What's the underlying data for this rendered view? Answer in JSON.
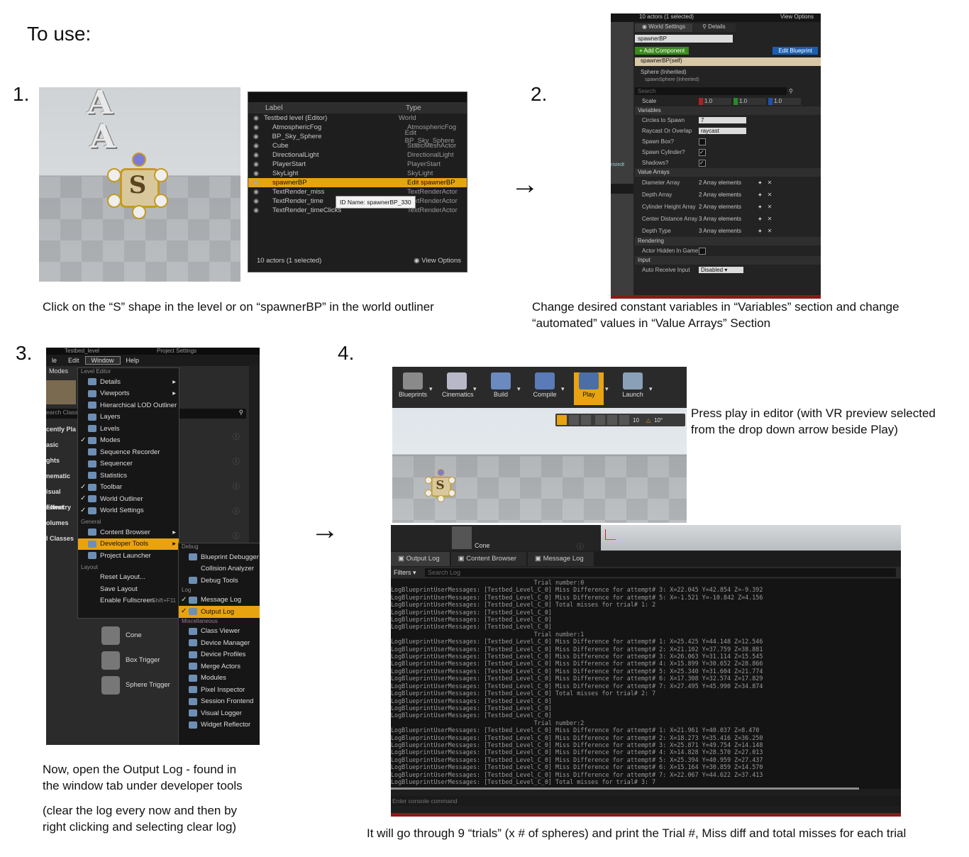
{
  "heading": "To use:",
  "steps": [
    {
      "num": "1.",
      "caption": "Click on the “S” shape in the level or on “spawnerBP” in the world outliner"
    },
    {
      "num": "2.",
      "caption_line1": "Change desired constant variables in “Variables” section and change",
      "caption_line2": "“automated” values in “Value Arrays” Section"
    },
    {
      "num": "3.",
      "caption_line1": "Now, open the Output Log - found in",
      "caption_line2": "the window tab under developer tools",
      "note_line1": "(clear the log every now and then by",
      "note_line2": "right clicking and selecting clear log)"
    },
    {
      "num": "4.",
      "caption_line1": "Press play in editor (with VR preview selected",
      "caption_line2": "from the drop down arrow beside Play)",
      "bottom_caption": "It will go through 9 “trials” (x # of spheres) and print the Trial #, Miss diff and total misses for each trial"
    }
  ],
  "arrows": [
    "→",
    "→"
  ],
  "viewport1": {
    "letters": [
      "A",
      "A"
    ],
    "spawner_letter": "S"
  },
  "outliner": {
    "col_label": "Label",
    "col_type": "Type",
    "rows": [
      {
        "label": "Testbed level (Editor)",
        "type": "World"
      },
      {
        "label": "AtmosphericFog",
        "type": "AtmosphericFog"
      },
      {
        "label": "BP_Sky_Sphere",
        "type": "Edit BP_Sky_Sphere"
      },
      {
        "label": "Cube",
        "type": "StaticMeshActor"
      },
      {
        "label": "DirectionalLight",
        "type": "DirectionalLight"
      },
      {
        "label": "PlayerStart",
        "type": "PlayerStart"
      },
      {
        "label": "SkyLight",
        "type": "SkyLight"
      },
      {
        "label": "spawnerBP",
        "type": "Edit spawnerBP"
      },
      {
        "label": "TextRender_miss",
        "type": "TextRenderActor"
      },
      {
        "label": "TextRender_time",
        "type": "TextRenderActor"
      },
      {
        "label": "TextRender_timeClicks",
        "type": "TextRenderActor"
      }
    ],
    "tooltip": "ID Name: spawnerBP_330",
    "footer": "10 actors (1 selected)",
    "view_options": "View Options"
  },
  "details": {
    "top_text": "10 actors (1 selected)",
    "view_options": "View Options",
    "tab_world": "World Settings",
    "tab_details": "Details",
    "name_field": "spawnerBP",
    "add_component": "+ Add Component",
    "edit_blueprint": "Edit Blueprint",
    "self_row": "spawnerBP(self)",
    "sphere_row": "Sphere (Inherited)",
    "sub_row": "spawnSphere (Inherited)",
    "search_placeholder": "Search",
    "scale_label": "Scale",
    "scale_x": "1.0",
    "scale_y": "1.0",
    "scale_z": "1.0",
    "sec_variables": "Variables",
    "variables": [
      {
        "name": "Circles to Spawn",
        "value": "7"
      },
      {
        "name": "Raycast Or Overlap",
        "value": "raycast"
      },
      {
        "name": "Spawn Box?",
        "value": ""
      },
      {
        "name": "Spawn Cylinder?",
        "value": ""
      },
      {
        "name": "Shadows?",
        "value": ""
      }
    ],
    "sec_arrays": "Value Arrays",
    "arrays": [
      {
        "name": "Diameter Array",
        "value": "2 Array elements"
      },
      {
        "name": "Depth Array",
        "value": "2 Array elements"
      },
      {
        "name": "Cylinder Height Array",
        "value": "2 Array elements"
      },
      {
        "name": "Center Distance Array",
        "value": "3 Array elements"
      },
      {
        "name": "Depth Type",
        "value": "3 Array elements"
      }
    ],
    "sec_rendering": "Rendering",
    "hidden_in_game": "Actor Hidden In Game",
    "sec_input": "Input",
    "auto_receive": "Auto Receive Input",
    "auto_receive_value": "Disabled",
    "side_label": "ristedt"
  },
  "window_menu": {
    "bar_tab1": "Testbed_level",
    "bar_tab2": "Project Settings",
    "menubar": [
      "le",
      "Edit",
      "Window",
      "Help"
    ],
    "modes_label": "Modes",
    "search_text": "earch Class",
    "left_cats": [
      "cently Pla",
      "asic",
      "ghts",
      "nematic",
      "isual Effect",
      "eometry",
      "olumes",
      "l Classes"
    ],
    "cat_level_editor": "Level Editor",
    "items1": [
      "Details",
      "Viewports",
      "Hierarchical LOD Outliner",
      "Layers",
      "Levels",
      "Modes",
      "Sequence Recorder",
      "Sequencer",
      "Statistics",
      "Toolbar",
      "World Outliner",
      "World Settings"
    ],
    "cat_general": "General",
    "items2": [
      "Content Browser",
      "Developer Tools",
      "Project Launcher"
    ],
    "cat_layout": "Layout",
    "items3": [
      "Reset Layout...",
      "Save Layout",
      "Enable Fullscreen"
    ],
    "fullscreen_shortcut": "Shift+F11",
    "sub_cat_debug": "Debug",
    "sub_debug": [
      "Blueprint Debugger",
      "Collision Analyzer",
      "Debug Tools"
    ],
    "sub_cat_log": "Log",
    "sub_log": [
      "Message Log",
      "Output Log"
    ],
    "sub_cat_misc": "Miscellaneous",
    "sub_misc": [
      "Class Viewer",
      "Device Manager",
      "Device Profiles",
      "Merge Actors",
      "Modules",
      "Pixel Inspector",
      "Session Frontend",
      "Visual Logger",
      "Widget Reflector"
    ],
    "shapes": [
      "Cone",
      "Box Trigger",
      "Sphere Trigger"
    ]
  },
  "toolbar4": {
    "buttons": [
      "Blueprints",
      "Cinematics",
      "Build",
      "Compile",
      "Play",
      "Launch"
    ],
    "viewport_values": [
      "10",
      "10°"
    ]
  },
  "outputlog": {
    "cone_label": "Cone",
    "tabs": [
      "Output Log",
      "Content Browser",
      "Message Log"
    ],
    "filters": "Filters",
    "search_placeholder": "Search Log",
    "console_placeholder": "Enter console command",
    "lines": [
      "                                        Trial number:0",
      "LogBlueprintUserMessages: [Testbed_Level_C_0] Miss Difference for attempt# 3: X=22.045 Y=42.854 Z=-9.392",
      "LogBlueprintUserMessages: [Testbed_Level_C_0] Miss Difference for attempt# 5: X=-1.521 Y=-10.842 Z=4.156",
      "LogBlueprintUserMessages: [Testbed_Level_C_0] Total misses for trial# 1: 2",
      "LogBlueprintUserMessages: [Testbed_Level_C_0]",
      "LogBlueprintUserMessages: [Testbed_Level_C_0]",
      "LogBlueprintUserMessages: [Testbed_Level_C_0]",
      "                                        Trial number:1",
      "LogBlueprintUserMessages: [Testbed_Level_C_0] Miss Difference for attempt# 1: X=25.425 Y=44.148 Z=12.546",
      "LogBlueprintUserMessages: [Testbed_Level_C_0] Miss Difference for attempt# 2: X=21.102 Y=37.759 Z=38.881",
      "LogBlueprintUserMessages: [Testbed_Level_C_0] Miss Difference for attempt# 3: X=26.063 Y=31.114 Z=15.545",
      "LogBlueprintUserMessages: [Testbed_Level_C_0] Miss Difference for attempt# 4: X=15.899 Y=30.652 Z=28.866",
      "LogBlueprintUserMessages: [Testbed_Level_C_0] Miss Difference for attempt# 5: X=25.340 Y=31.604 Z=21.774",
      "LogBlueprintUserMessages: [Testbed_Level_C_0] Miss Difference for attempt# 6: X=17.308 Y=32.574 Z=17.829",
      "LogBlueprintUserMessages: [Testbed_Level_C_0] Miss Difference for attempt# 7: X=27.495 Y=45.990 Z=34.874",
      "LogBlueprintUserMessages: [Testbed_Level_C_0] Total misses for trial# 2: 7",
      "LogBlueprintUserMessages: [Testbed_Level_C_0]",
      "LogBlueprintUserMessages: [Testbed_Level_C_0]",
      "LogBlueprintUserMessages: [Testbed_Level_C_0]",
      "                                        Trial number:2",
      "LogBlueprintUserMessages: [Testbed_Level_C_0] Miss Difference for attempt# 1: X=21.961 Y=40.037 Z=8.470",
      "LogBlueprintUserMessages: [Testbed_Level_C_0] Miss Difference for attempt# 2: X=18.273 Y=35.416 Z=36.250",
      "LogBlueprintUserMessages: [Testbed_Level_C_0] Miss Difference for attempt# 3: X=25.871 Y=49.754 Z=14.148",
      "LogBlueprintUserMessages: [Testbed_Level_C_0] Miss Difference for attempt# 4: X=14.828 Y=28.570 Z=27.013",
      "LogBlueprintUserMessages: [Testbed_Level_C_0] Miss Difference for attempt# 5: X=25.394 Y=40.959 Z=27.437",
      "LogBlueprintUserMessages: [Testbed_Level_C_0] Miss Difference for attempt# 6: X=15.164 Y=30.859 Z=14.570",
      "LogBlueprintUserMessages: [Testbed_Level_C_0] Miss Difference for attempt# 7: X=22.067 Y=44.622 Z=37.413",
      "LogBlueprintUserMessages: [Testbed_Level_C_0] Total misses for trial# 3: 7"
    ]
  },
  "colors": {
    "selection": "#e8a310",
    "add_component": "#3a8a1c",
    "edit_blueprint": "#1a5fb0",
    "accent_red": "#8a1a1a"
  }
}
